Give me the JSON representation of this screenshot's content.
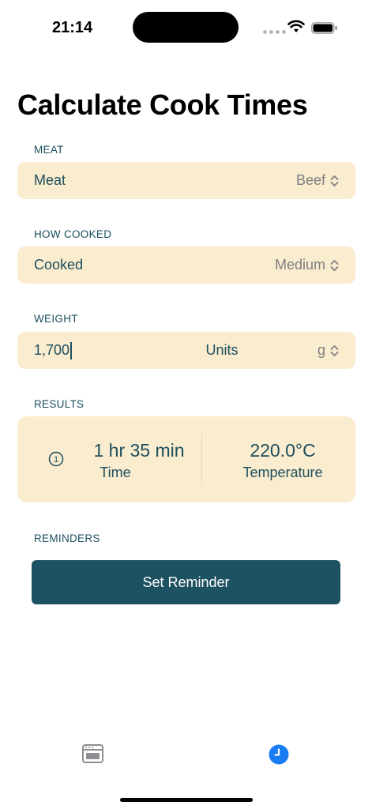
{
  "status_bar": {
    "time": "21:14"
  },
  "page_title": "Calculate Cook Times",
  "meat": {
    "section_label": "MEAT",
    "field_label": "Meat",
    "selected": "Beef"
  },
  "how_cooked": {
    "section_label": "HOW COOKED",
    "field_label": "Cooked",
    "selected": "Medium"
  },
  "weight": {
    "section_label": "WEIGHT",
    "value": "1,700",
    "units_label": "Units",
    "unit_selected": "g"
  },
  "results": {
    "section_label": "RESULTS",
    "step_number": "1",
    "time_value": "1 hr 35 min",
    "time_caption": "Time",
    "temperature_value": "220.0°C",
    "temperature_caption": "Temperature"
  },
  "reminders": {
    "section_label": "REMINDERS",
    "button_label": "Set Reminder"
  },
  "tab_bar": {
    "items": [
      {
        "icon": "oven-icon",
        "selected": false
      },
      {
        "icon": "timer-icon",
        "selected": true
      }
    ]
  },
  "colors": {
    "accent": "#1d5262",
    "field_background": "#faecce",
    "tab_selected": "#1a7cf3",
    "tab_unselected": "#8e8e93"
  }
}
